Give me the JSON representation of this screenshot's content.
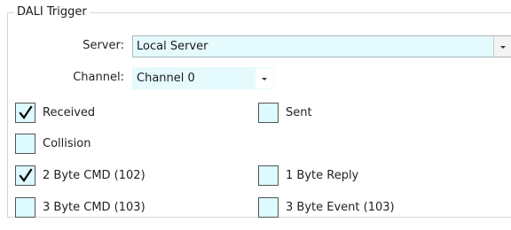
{
  "group": {
    "title": "DALI Trigger"
  },
  "server": {
    "label": "Server:",
    "value": "Local Server"
  },
  "channel": {
    "label": "Channel:",
    "value": "Channel 0"
  },
  "checkboxes": {
    "received": {
      "label": "Received",
      "checked": true
    },
    "sent": {
      "label": "Sent",
      "checked": false
    },
    "collision": {
      "label": "Collision",
      "checked": false
    },
    "cmd2": {
      "label": "2 Byte CMD (102)",
      "checked": true
    },
    "reply1": {
      "label": "1 Byte Reply",
      "checked": false
    },
    "cmd3": {
      "label": "3 Byte CMD (103)",
      "checked": false
    },
    "event3": {
      "label": "3 Byte Event (103)",
      "checked": false
    }
  },
  "icons": {
    "dropdown": "chevron-down-icon",
    "check": "checkmark-icon"
  },
  "colors": {
    "field_bg": "#e5fafd",
    "checkbox_bg": "#dcfaff"
  }
}
